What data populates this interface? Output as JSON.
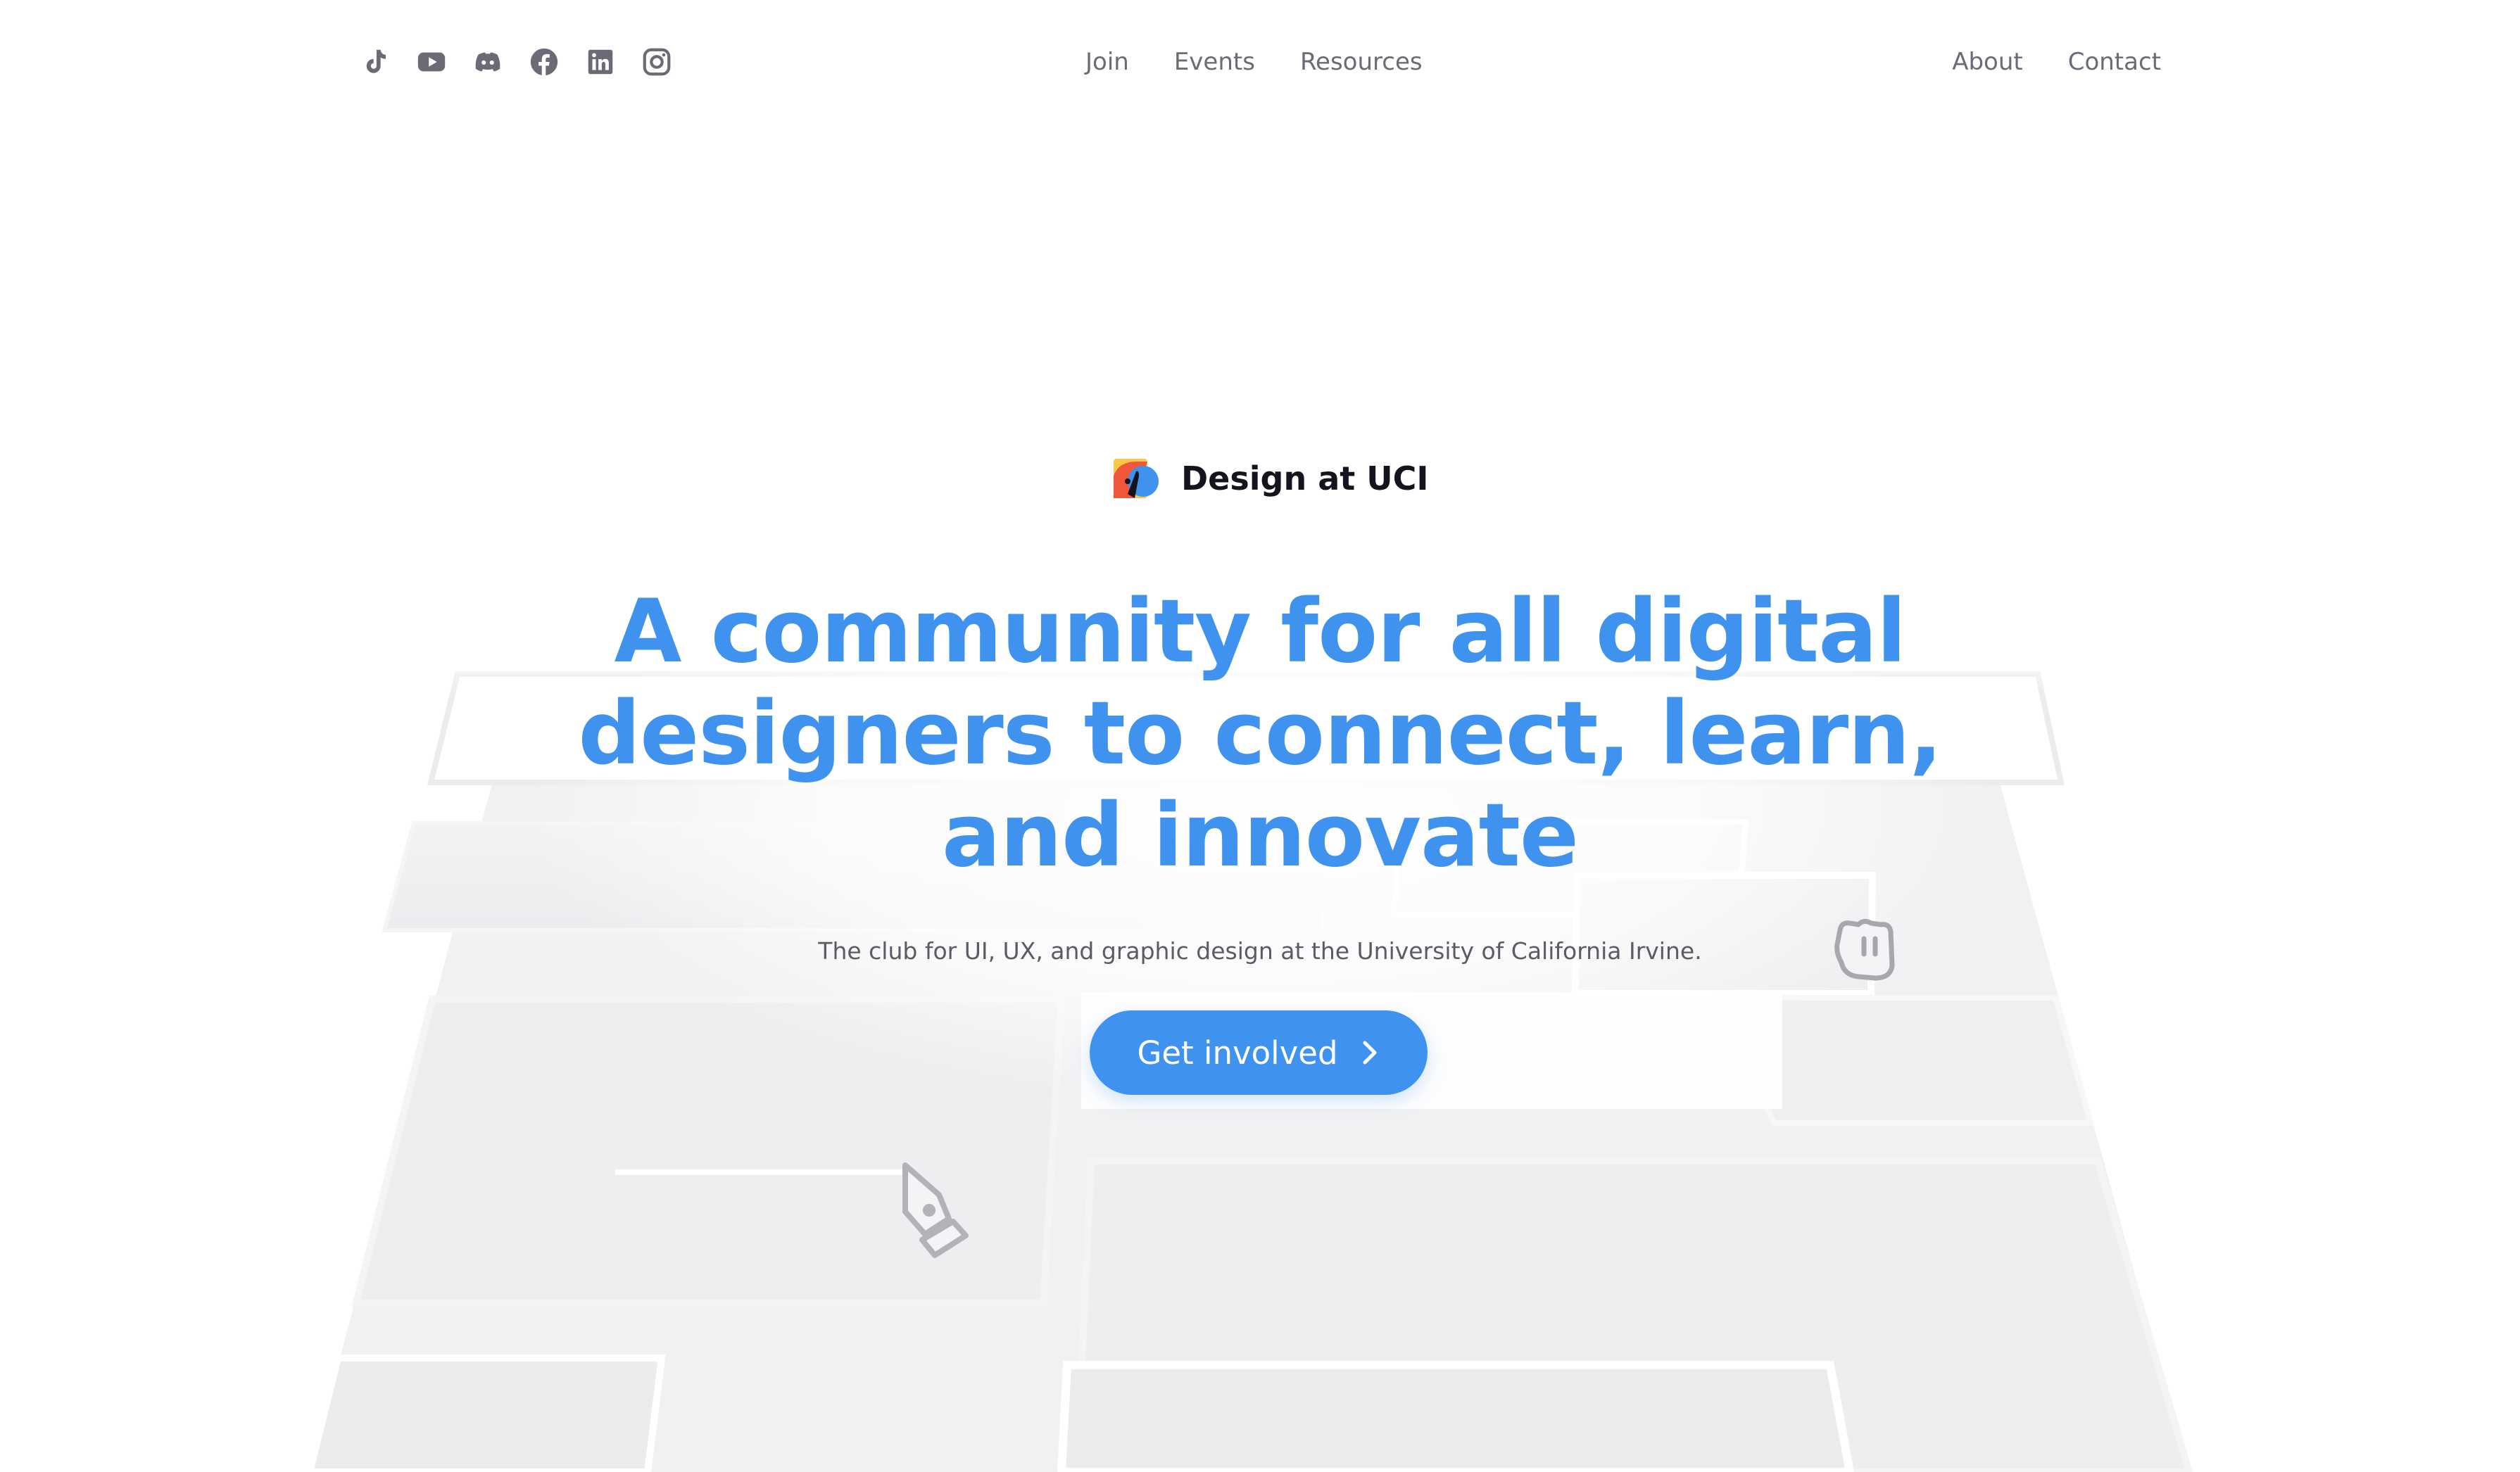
{
  "header": {
    "social_icons": [
      "tiktok-icon",
      "youtube-icon",
      "discord-icon",
      "facebook-icon",
      "linkedin-icon",
      "instagram-icon"
    ],
    "nav_center": [
      "Join",
      "Events",
      "Resources"
    ],
    "nav_right": [
      "About",
      "Contact"
    ]
  },
  "brand": {
    "name": "Design at UCI",
    "logo_colors": [
      "#f7c948",
      "#f0563a",
      "#3f93ee",
      "#14141f"
    ]
  },
  "hero": {
    "headline_lines": [
      "A community for all digital",
      "designers to connect, learn,",
      "and innovate"
    ],
    "subtitle": "The club for UI, UX, and graphic design at the University of California Irvine.",
    "cta_label": "Get involved",
    "cta_icon": "chevron-right-icon"
  },
  "decorations": [
    "pen-tool-icon",
    "grab-hand-icon"
  ],
  "colors": {
    "accent": "#3f93ee",
    "nav_text": "#6b6b78",
    "heading_dark": "#14141f",
    "panel": "#f0f0f2"
  }
}
